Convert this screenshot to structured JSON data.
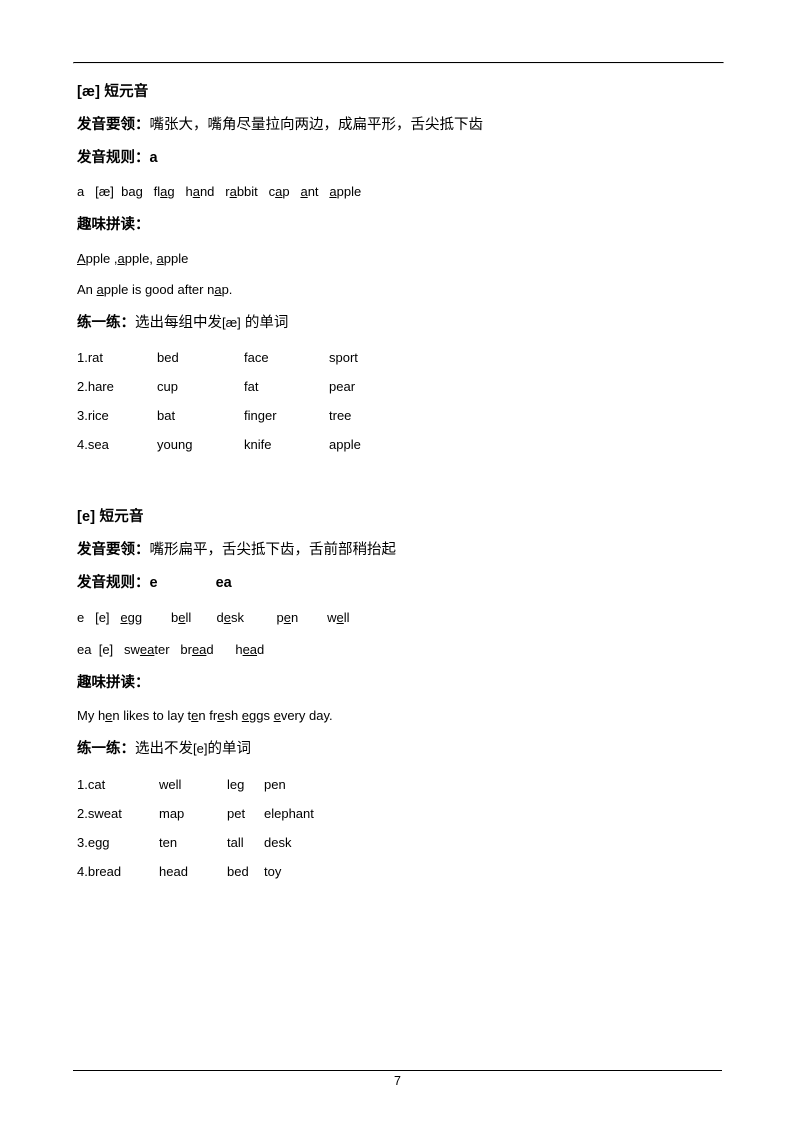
{
  "document": {
    "page_number": "7"
  },
  "sections": [
    {
      "id": "ae",
      "heading": "[æ] 短元音",
      "essentials_label": "发音要领：",
      "essentials_text": "嘴张大，嘴角尽量拉向两边，成扁平形，舌尖抵下齿",
      "rule_label": "发音规则：",
      "rule_value": "a",
      "rule_value_2": "",
      "word_row_letters": "a",
      "word_row_ipa": "[æ]",
      "words": [
        "bag",
        "flag",
        "hand",
        "rabbit",
        "cap",
        "ant",
        "apple"
      ],
      "fun_label": "趣味拼读：",
      "fun_lines": [
        "Apple ,apple, apple",
        "An apple is good after nap."
      ],
      "practice_label": "练一练：",
      "practice_text_before": "选出每组中发",
      "practice_ipa": "[æ]",
      "practice_text_after": " 的单词",
      "exercise": {
        "rows": [
          [
            "1.rat",
            "bed",
            "face",
            "sport"
          ],
          [
            "2.hare",
            "cup",
            "fat",
            "pear"
          ],
          [
            "3.rice",
            "bat",
            "finger",
            "tree"
          ],
          [
            "4.sea",
            "young",
            "knife",
            "apple"
          ]
        ]
      }
    },
    {
      "id": "e",
      "heading": "[e] 短元音",
      "essentials_label": "发音要领：",
      "essentials_text": "嘴形扁平，舌尖抵下齿，舌前部稍抬起",
      "rule_label": "发音规则：",
      "rule_value": "e",
      "rule_value_2": "ea",
      "word_rows": [
        {
          "letters": "e",
          "ipa": "[e]",
          "words": [
            "egg",
            "bell",
            "desk",
            "pen",
            "well"
          ]
        },
        {
          "letters": "ea",
          "ipa": "[e]",
          "words": [
            "sweater",
            "bread",
            "head"
          ]
        }
      ],
      "fun_label": "趣味拼读：",
      "fun_lines": [
        "My hen likes to lay ten fresh eggs every day."
      ],
      "practice_label": "练一练：",
      "practice_text_before": "选出不发",
      "practice_ipa": "[e]",
      "practice_text_after": "的单词",
      "exercise": {
        "rows": [
          [
            "1.cat",
            "well",
            "leg",
            "pen"
          ],
          [
            "2.sweat",
            "map",
            "pet",
            "elephant"
          ],
          [
            "3.egg",
            "ten",
            "tall",
            "desk"
          ],
          [
            "4.bread",
            "head",
            "bed",
            "toy"
          ]
        ]
      }
    }
  ]
}
